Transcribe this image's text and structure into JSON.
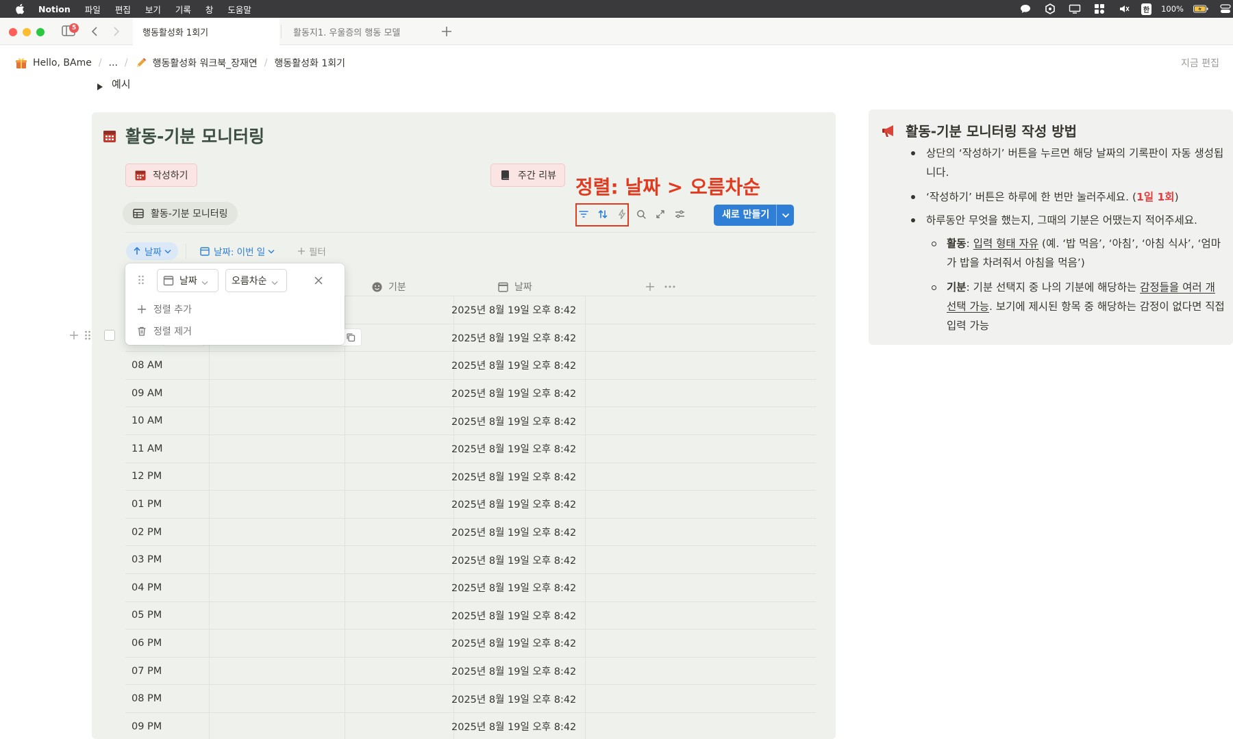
{
  "menubar": {
    "app": "Notion",
    "items": [
      "파일",
      "편집",
      "보기",
      "기록",
      "창",
      "도움말"
    ],
    "input_indicator": "한",
    "battery": "100%"
  },
  "tabs": {
    "badge_count": "5",
    "active": "행동활성화 1회기",
    "inactive": "활동지1. 우울증의 행동 모델"
  },
  "breadcrumb": {
    "workspace": "Hello, BAme",
    "ellipsis": "...",
    "parent": "행동활성화 워크북_장재연",
    "current": "행동활성화 1회기",
    "edited": "지금 편집"
  },
  "toggle_example": "예시",
  "database": {
    "title": "활동-기분 모니터링",
    "write_button": "작성하기",
    "review_button": "주간 리뷰",
    "annotation": "정렬: 날짜 > 오름차순",
    "view_tab": "활동-기분 모니터링",
    "new_button": "새로 만들기",
    "sort_chip": "날짜",
    "date_filter_chip": "날짜: 이번 일",
    "filter_chip": "필터",
    "columns": {
      "mood": "기분",
      "date": "날짜"
    },
    "rows": [
      {
        "time": "",
        "date": "2025년 8월 19일 오후 8:42"
      },
      {
        "time": "",
        "date": "2025년 8월 19일 오후 8:42"
      },
      {
        "time": "08 AM",
        "date": "2025년 8월 19일 오후 8:42"
      },
      {
        "time": "09 AM",
        "date": "2025년 8월 19일 오후 8:42"
      },
      {
        "time": "10 AM",
        "date": "2025년 8월 19일 오후 8:42"
      },
      {
        "time": "11 AM",
        "date": "2025년 8월 19일 오후 8:42"
      },
      {
        "time": "12 PM",
        "date": "2025년 8월 19일 오후 8:42"
      },
      {
        "time": "01 PM",
        "date": "2025년 8월 19일 오후 8:42"
      },
      {
        "time": "02 PM",
        "date": "2025년 8월 19일 오후 8:42"
      },
      {
        "time": "03 PM",
        "date": "2025년 8월 19일 오후 8:42"
      },
      {
        "time": "04 PM",
        "date": "2025년 8월 19일 오후 8:42"
      },
      {
        "time": "05 PM",
        "date": "2025년 8월 19일 오후 8:42"
      },
      {
        "time": "06 PM",
        "date": "2025년 8월 19일 오후 8:42"
      },
      {
        "time": "07 PM",
        "date": "2025년 8월 19일 오후 8:42"
      },
      {
        "time": "08 PM",
        "date": "2025년 8월 19일 오후 8:42"
      },
      {
        "time": "09 PM",
        "date": "2025년 8월 19일 오후 8:42"
      }
    ]
  },
  "sort_popup": {
    "property": "날짜",
    "direction": "오름차순",
    "add_sort": "정렬 추가",
    "remove_sort": "정렬 제거"
  },
  "guide": {
    "title": "활동-기분 모니터링 작성 방법",
    "b1": "상단의 ‘작성하기’ 버튼을 누르면 해당 날짜의 기록판이 자동 생성됩니다.",
    "b2_pre": "‘작성하기’ 버튼은 하루에 한 번만 눌러주세요. (",
    "b2_red": "1일 1회",
    "b2_post": ")",
    "b3": "하루동안 무엇을 했는지, 그때의 기분은 어땠는지 적어주세요.",
    "b4_label": "활동",
    "b4_colon": ": ",
    "b4_ul": "입력 형태 자유",
    "b4_rest": " (예. ‘밥 먹음’, ‘아침’, ‘아침 식사’, ‘엄마가 밥을 차려줘서 아침을 먹음’)",
    "b5_label": "기분",
    "b5_pre": ":  기분 선택지 중 나의 기분에 해당하는 ",
    "b5_ul": "감정들을 여러 개 선택 가능",
    "b5_post": ". 보기에 제시된 항목 중 해당하는 감정이 없다면 직접 입력 가능"
  },
  "colors": {
    "accent_blue": "#2f7fd6",
    "annotation_red": "#e23a1f",
    "callout_green": "#eef1ec",
    "button_pink": "#fbe4e4"
  }
}
